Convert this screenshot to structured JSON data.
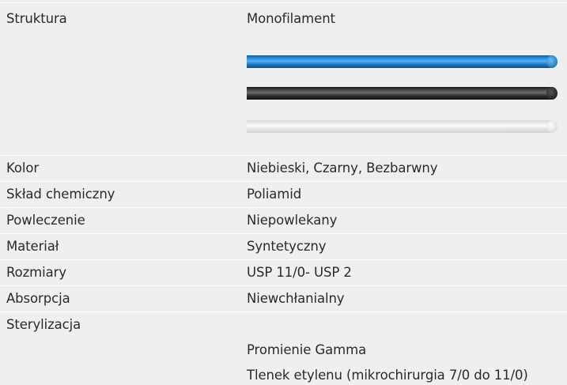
{
  "rows": [
    {
      "label": "Struktura",
      "value": "Monofilament"
    },
    {
      "label": "Kolor",
      "value": "Niebieski, Czarny, Bezbarwny"
    },
    {
      "label": "Skład chemiczny",
      "value": "Poliamid"
    },
    {
      "label": "Powleczenie",
      "value": "Niepowlekany"
    },
    {
      "label": "Materiał",
      "value": "Syntetyczny"
    },
    {
      "label": "Rozmiary",
      "value": "USP 11/0- USP 2"
    },
    {
      "label": "Absorpcja",
      "value": "Niewchłanialny"
    },
    {
      "label": "Sterylizacja",
      "value": "Promienie Gamma",
      "value2": "Tlenek etylenu (mikrochirurgia 7/0 do 11/0)"
    }
  ],
  "suture_colors": {
    "blue": "#2a8ad8",
    "black": "#3a3a3a",
    "clear": "#f0f0f0"
  }
}
